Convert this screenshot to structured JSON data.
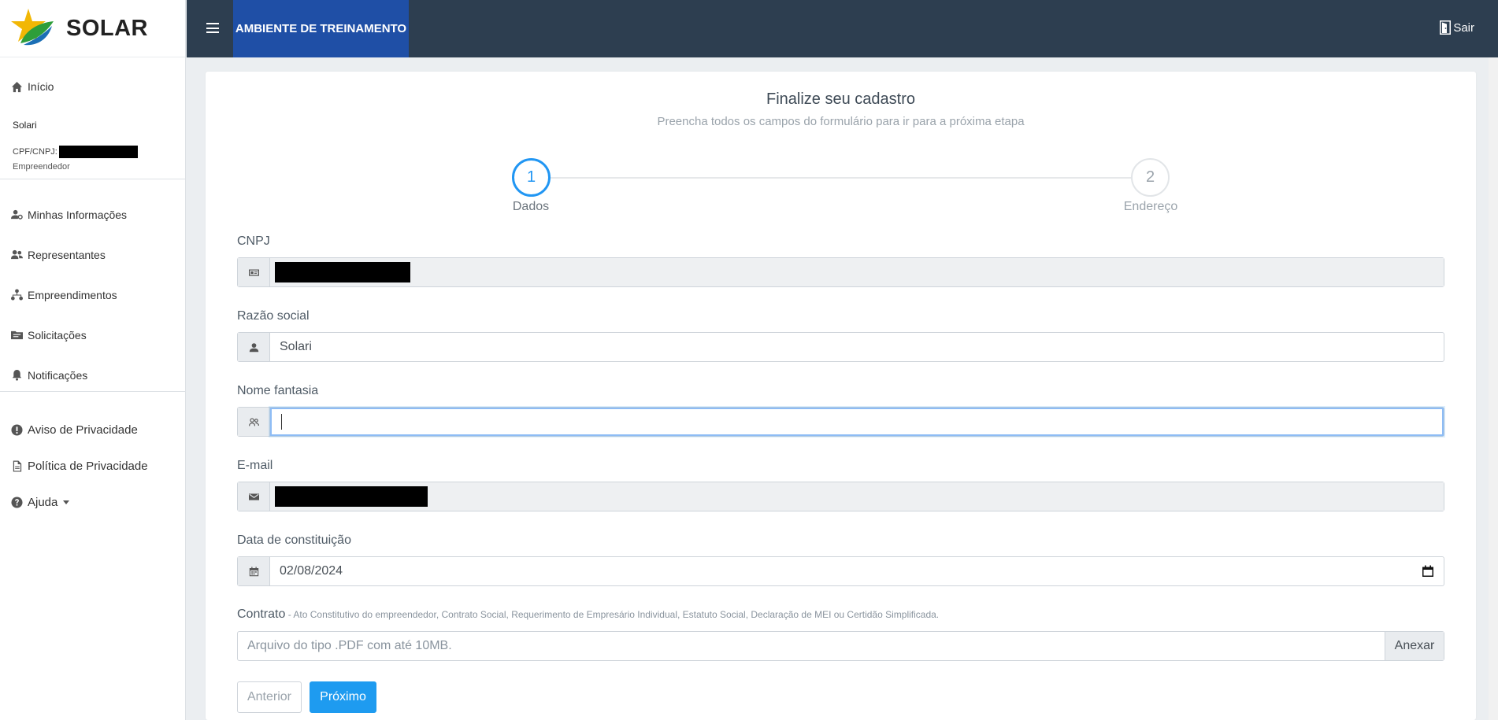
{
  "sidebar": {
    "brand": "SOLAR",
    "home_label": "Início",
    "user": {
      "name": "Solari",
      "cpf_label": "CPF/CNPJ:",
      "role": "Empreendedor"
    },
    "items": [
      {
        "label": "Minhas Informações",
        "icon": "user-gear-icon"
      },
      {
        "label": "Representantes",
        "icon": "users-icon"
      },
      {
        "label": "Empreendimentos",
        "icon": "sitemap-icon"
      },
      {
        "label": "Solicitações",
        "icon": "folder-icon"
      },
      {
        "label": "Notificações",
        "icon": "bell-icon"
      }
    ],
    "links": [
      {
        "label": "Aviso de Privacidade",
        "icon": "exclamation-circle-icon"
      },
      {
        "label": "Política de Privacidade",
        "icon": "file-icon"
      },
      {
        "label": "Ajuda",
        "icon": "question-circle-icon"
      }
    ]
  },
  "topbar": {
    "env_label": "AMBIENTE DE TREINAMENTO",
    "logout_label": "Sair"
  },
  "form": {
    "title": "Finalize seu cadastro",
    "subtitle": "Preencha todos os campos do formulário para ir para a próxima etapa",
    "steps": [
      {
        "number": "1",
        "label": "Dados",
        "active": true
      },
      {
        "number": "2",
        "label": "Endereço",
        "active": false
      }
    ],
    "fields": {
      "cnpj": {
        "label": "CNPJ",
        "value": ""
      },
      "razao_social": {
        "label": "Razão social",
        "value": "Solari"
      },
      "nome_fantasia": {
        "label": "Nome fantasia",
        "value": ""
      },
      "email": {
        "label": "E-mail",
        "value": ""
      },
      "data_constituicao": {
        "label": "Data de constituição",
        "value": "02/08/2024"
      }
    },
    "contrato": {
      "label": "Contrato",
      "hint": " - Ato Constitutivo do empreendedor, Contrato Social, Requerimento de Empresário Individual, Estatuto Social, Declaração de MEI ou Certidão Simplificada.",
      "placeholder": "Arquivo do tipo .PDF com até 10MB.",
      "button": "Anexar"
    },
    "buttons": {
      "prev": "Anterior",
      "next": "Próximo"
    }
  },
  "colors": {
    "topbar": "#2d3e50",
    "env_tab": "#1f4fa6",
    "accent": "#2196f3",
    "primary_button": "#1e9bf0"
  }
}
